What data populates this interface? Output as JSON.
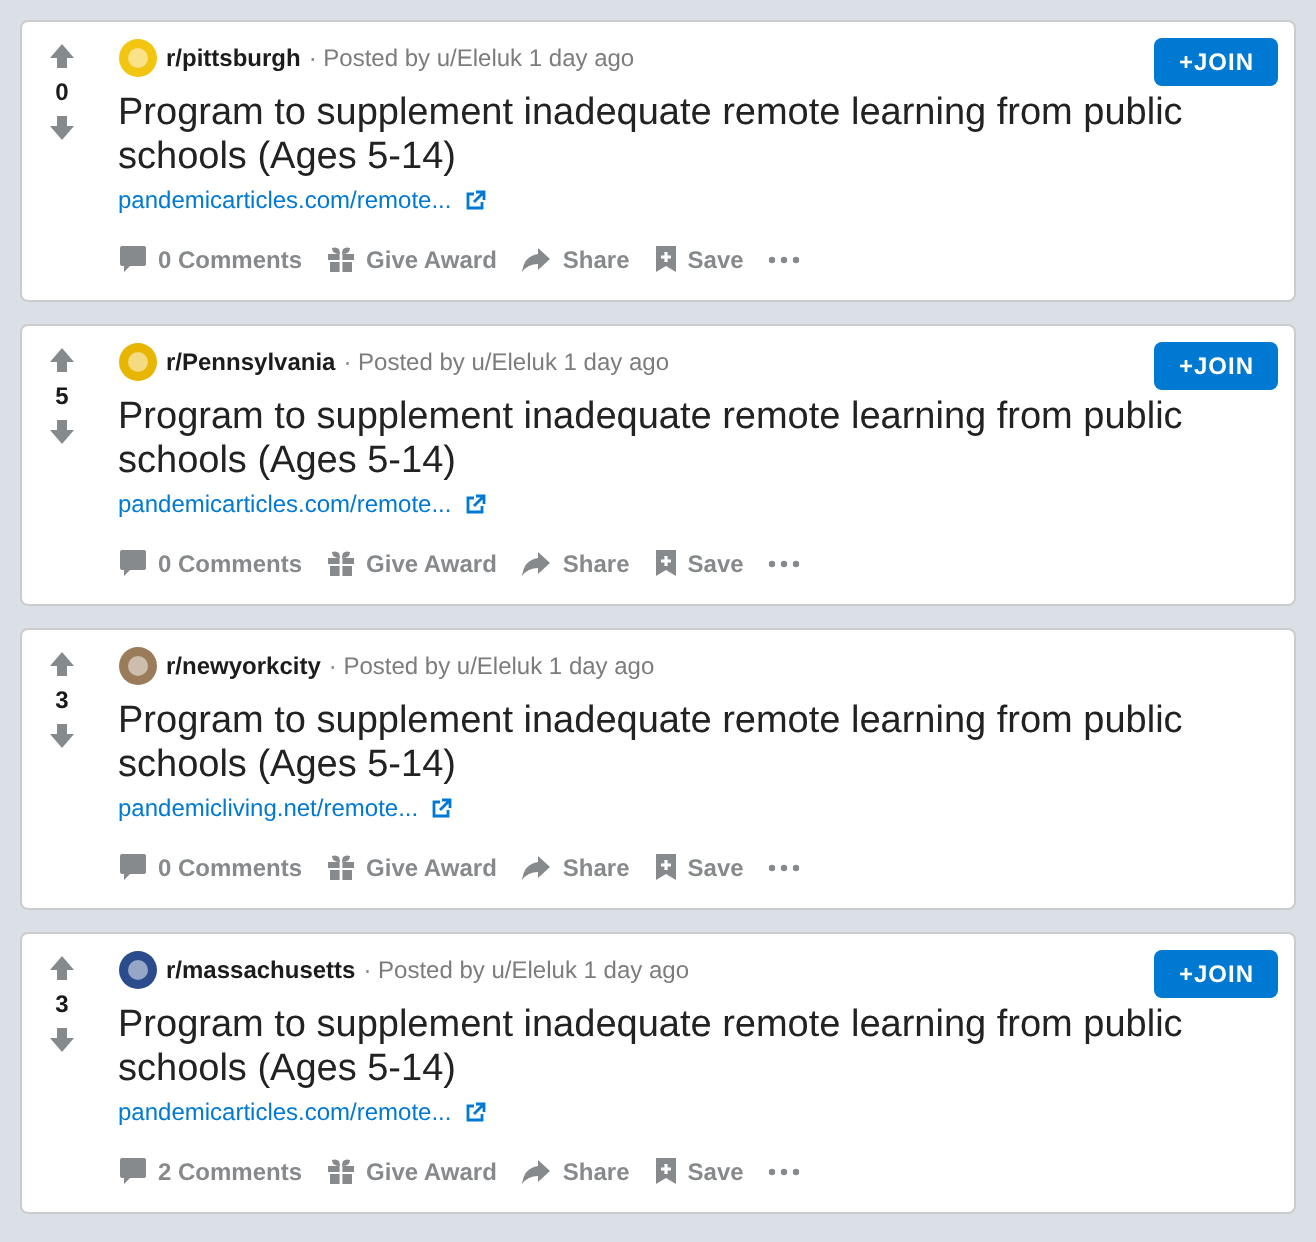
{
  "posts": [
    {
      "score": "0",
      "subreddit": "r/pittsburgh",
      "color": "#f2c510",
      "byline": "· Posted by u/Eleluk 1 day ago",
      "join": "+JOIN",
      "title": "Program to supplement inadequate remote learning from public schools (Ages 5-14)",
      "link": "pandemicarticles.com/remote...",
      "actions": {
        "comments": "0 Comments",
        "award": "Give Award",
        "share": "Share",
        "save": "Save"
      }
    },
    {
      "score": "5",
      "subreddit": "r/Pennsylvania",
      "color": "#e8b500",
      "byline": "· Posted by u/Eleluk 1 day ago",
      "join": "+JOIN",
      "title": "Program to supplement inadequate remote learning from public schools (Ages 5-14)",
      "link": "pandemicarticles.com/remote...",
      "actions": {
        "comments": "0 Comments",
        "award": "Give Award",
        "share": "Share",
        "save": "Save"
      }
    },
    {
      "score": "3",
      "subreddit": "r/newyorkcity",
      "color": "#9a7b5a",
      "byline": "· Posted by u/Eleluk 1 day ago",
      "title": "Program to supplement inadequate remote learning from public schools (Ages 5-14)",
      "link": "pandemicliving.net/remote...",
      "actions": {
        "comments": "0 Comments",
        "award": "Give Award",
        "share": "Share",
        "save": "Save"
      }
    },
    {
      "score": "3",
      "subreddit": "r/massachusetts",
      "color": "#2b4c8c",
      "byline": "· Posted by u/Eleluk 1 day ago",
      "join": "+JOIN",
      "title": "Program to supplement inadequate remote learning from public schools (Ages 5-14)",
      "link": "pandemicarticles.com/remote...",
      "actions": {
        "comments": "2 Comments",
        "award": "Give Award",
        "share": "Share",
        "save": "Save"
      }
    }
  ]
}
